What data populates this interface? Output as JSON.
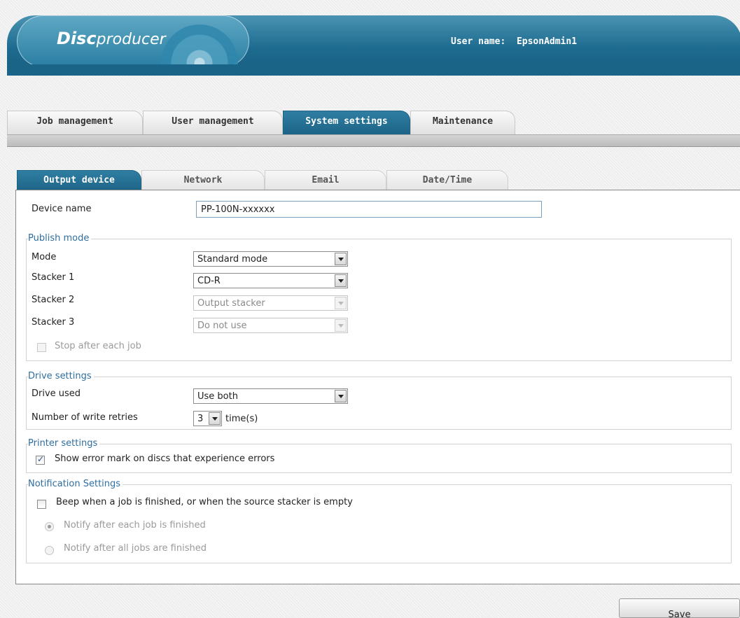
{
  "header": {
    "logo_bold": "Disc",
    "logo_rest": "producer",
    "user_label": "User name:",
    "user_value": "EpsonAdmin1"
  },
  "main_tabs": [
    {
      "label": "Job management",
      "active": false
    },
    {
      "label": "User management",
      "active": false
    },
    {
      "label": "System settings",
      "active": true
    },
    {
      "label": "Maintenance",
      "active": false
    }
  ],
  "sub_tabs": [
    {
      "label": "Output device",
      "active": true
    },
    {
      "label": "Network",
      "active": false
    },
    {
      "label": "Email",
      "active": false
    },
    {
      "label": "Date/Time",
      "active": false
    }
  ],
  "device": {
    "label": "Device name",
    "value": "PP-100N-xxxxxx"
  },
  "publish_mode": {
    "legend": "Publish mode",
    "mode_label": "Mode",
    "mode_value": "Standard mode",
    "stacker1_label": "Stacker 1",
    "stacker1_value": "CD-R",
    "stacker2_label": "Stacker 2",
    "stacker2_value": "Output stacker",
    "stacker3_label": "Stacker 3",
    "stacker3_value": "Do not use",
    "stop_label": "Stop after each job",
    "stop_checked": false
  },
  "drive_settings": {
    "legend": "Drive settings",
    "drive_label": "Drive used",
    "drive_value": "Use both",
    "retries_label": "Number of write retries",
    "retries_value": "3",
    "retries_unit": "time(s)"
  },
  "printer_settings": {
    "legend": "Printer settings",
    "error_mark_label": "Show error mark on discs that experience errors",
    "error_mark_checked": true
  },
  "notification": {
    "legend": "Notification Settings",
    "beep_label": "Beep when a job is finished, or when the source stacker is empty",
    "beep_checked": false,
    "radio1_label": "Notify after each job is finished",
    "radio1_checked": true,
    "radio2_label": "Notify after all jobs are finished",
    "radio2_checked": false
  },
  "actions": {
    "save_label": "Save"
  }
}
